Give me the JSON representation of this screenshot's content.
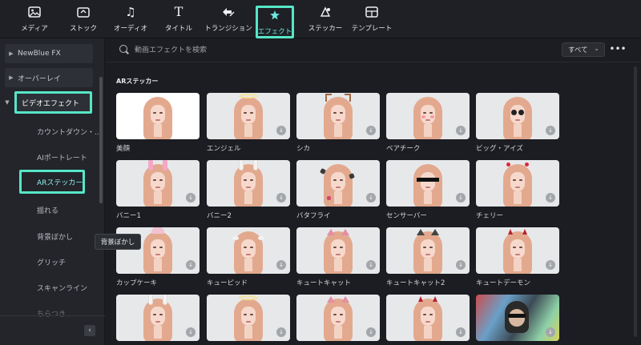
{
  "toolbar": {
    "items": [
      {
        "label": "メディア",
        "icon": "media-icon"
      },
      {
        "label": "ストック",
        "icon": "stock-icon"
      },
      {
        "label": "オーディオ",
        "icon": "audio-icon"
      },
      {
        "label": "タイトル",
        "icon": "title-icon"
      },
      {
        "label": "トランジション",
        "icon": "transition-icon"
      },
      {
        "label": "エフェクト",
        "icon": "effect-icon",
        "active": true
      },
      {
        "label": "ステッカー",
        "icon": "sticker-icon"
      },
      {
        "label": "テンプレート",
        "icon": "template-icon"
      }
    ],
    "accent_color": "#57e6c7"
  },
  "sidebar": {
    "groups": [
      {
        "label": "NewBlue FX"
      },
      {
        "label": "オーバーレイ"
      },
      {
        "label": "ビデオエフェクト"
      }
    ],
    "subitems": [
      {
        "label": "カウントダウン・..."
      },
      {
        "label": "AIポートレート"
      },
      {
        "label": "ARステッカー"
      },
      {
        "label": "揺れる"
      },
      {
        "label": "背景ぼかし"
      },
      {
        "label": "グリッチ"
      },
      {
        "label": "スキャンライン"
      },
      {
        "label": "ちらつき"
      }
    ],
    "collapse_icon": "chevron-left-icon"
  },
  "search": {
    "placeholder": "動画エフェクトを検索",
    "filter_value": "すべて"
  },
  "section_title": "ARステッカー",
  "tooltip": "背景ぼかし",
  "effects": [
    {
      "label": "美顔"
    },
    {
      "label": "エンジェル"
    },
    {
      "label": "シカ"
    },
    {
      "label": "ベアチーク"
    },
    {
      "label": "ビッグ・アイズ"
    },
    {
      "label": "バニー1"
    },
    {
      "label": "バニー2"
    },
    {
      "label": "バタフライ"
    },
    {
      "label": "センサーバー"
    },
    {
      "label": "チェリー"
    },
    {
      "label": "カップケーキ"
    },
    {
      "label": "キューピッド"
    },
    {
      "label": "キュートキャット"
    },
    {
      "label": "キュートキャット2"
    },
    {
      "label": "キュートデーモン"
    },
    {
      "label": ""
    },
    {
      "label": ""
    },
    {
      "label": ""
    },
    {
      "label": ""
    },
    {
      "label": ""
    }
  ]
}
